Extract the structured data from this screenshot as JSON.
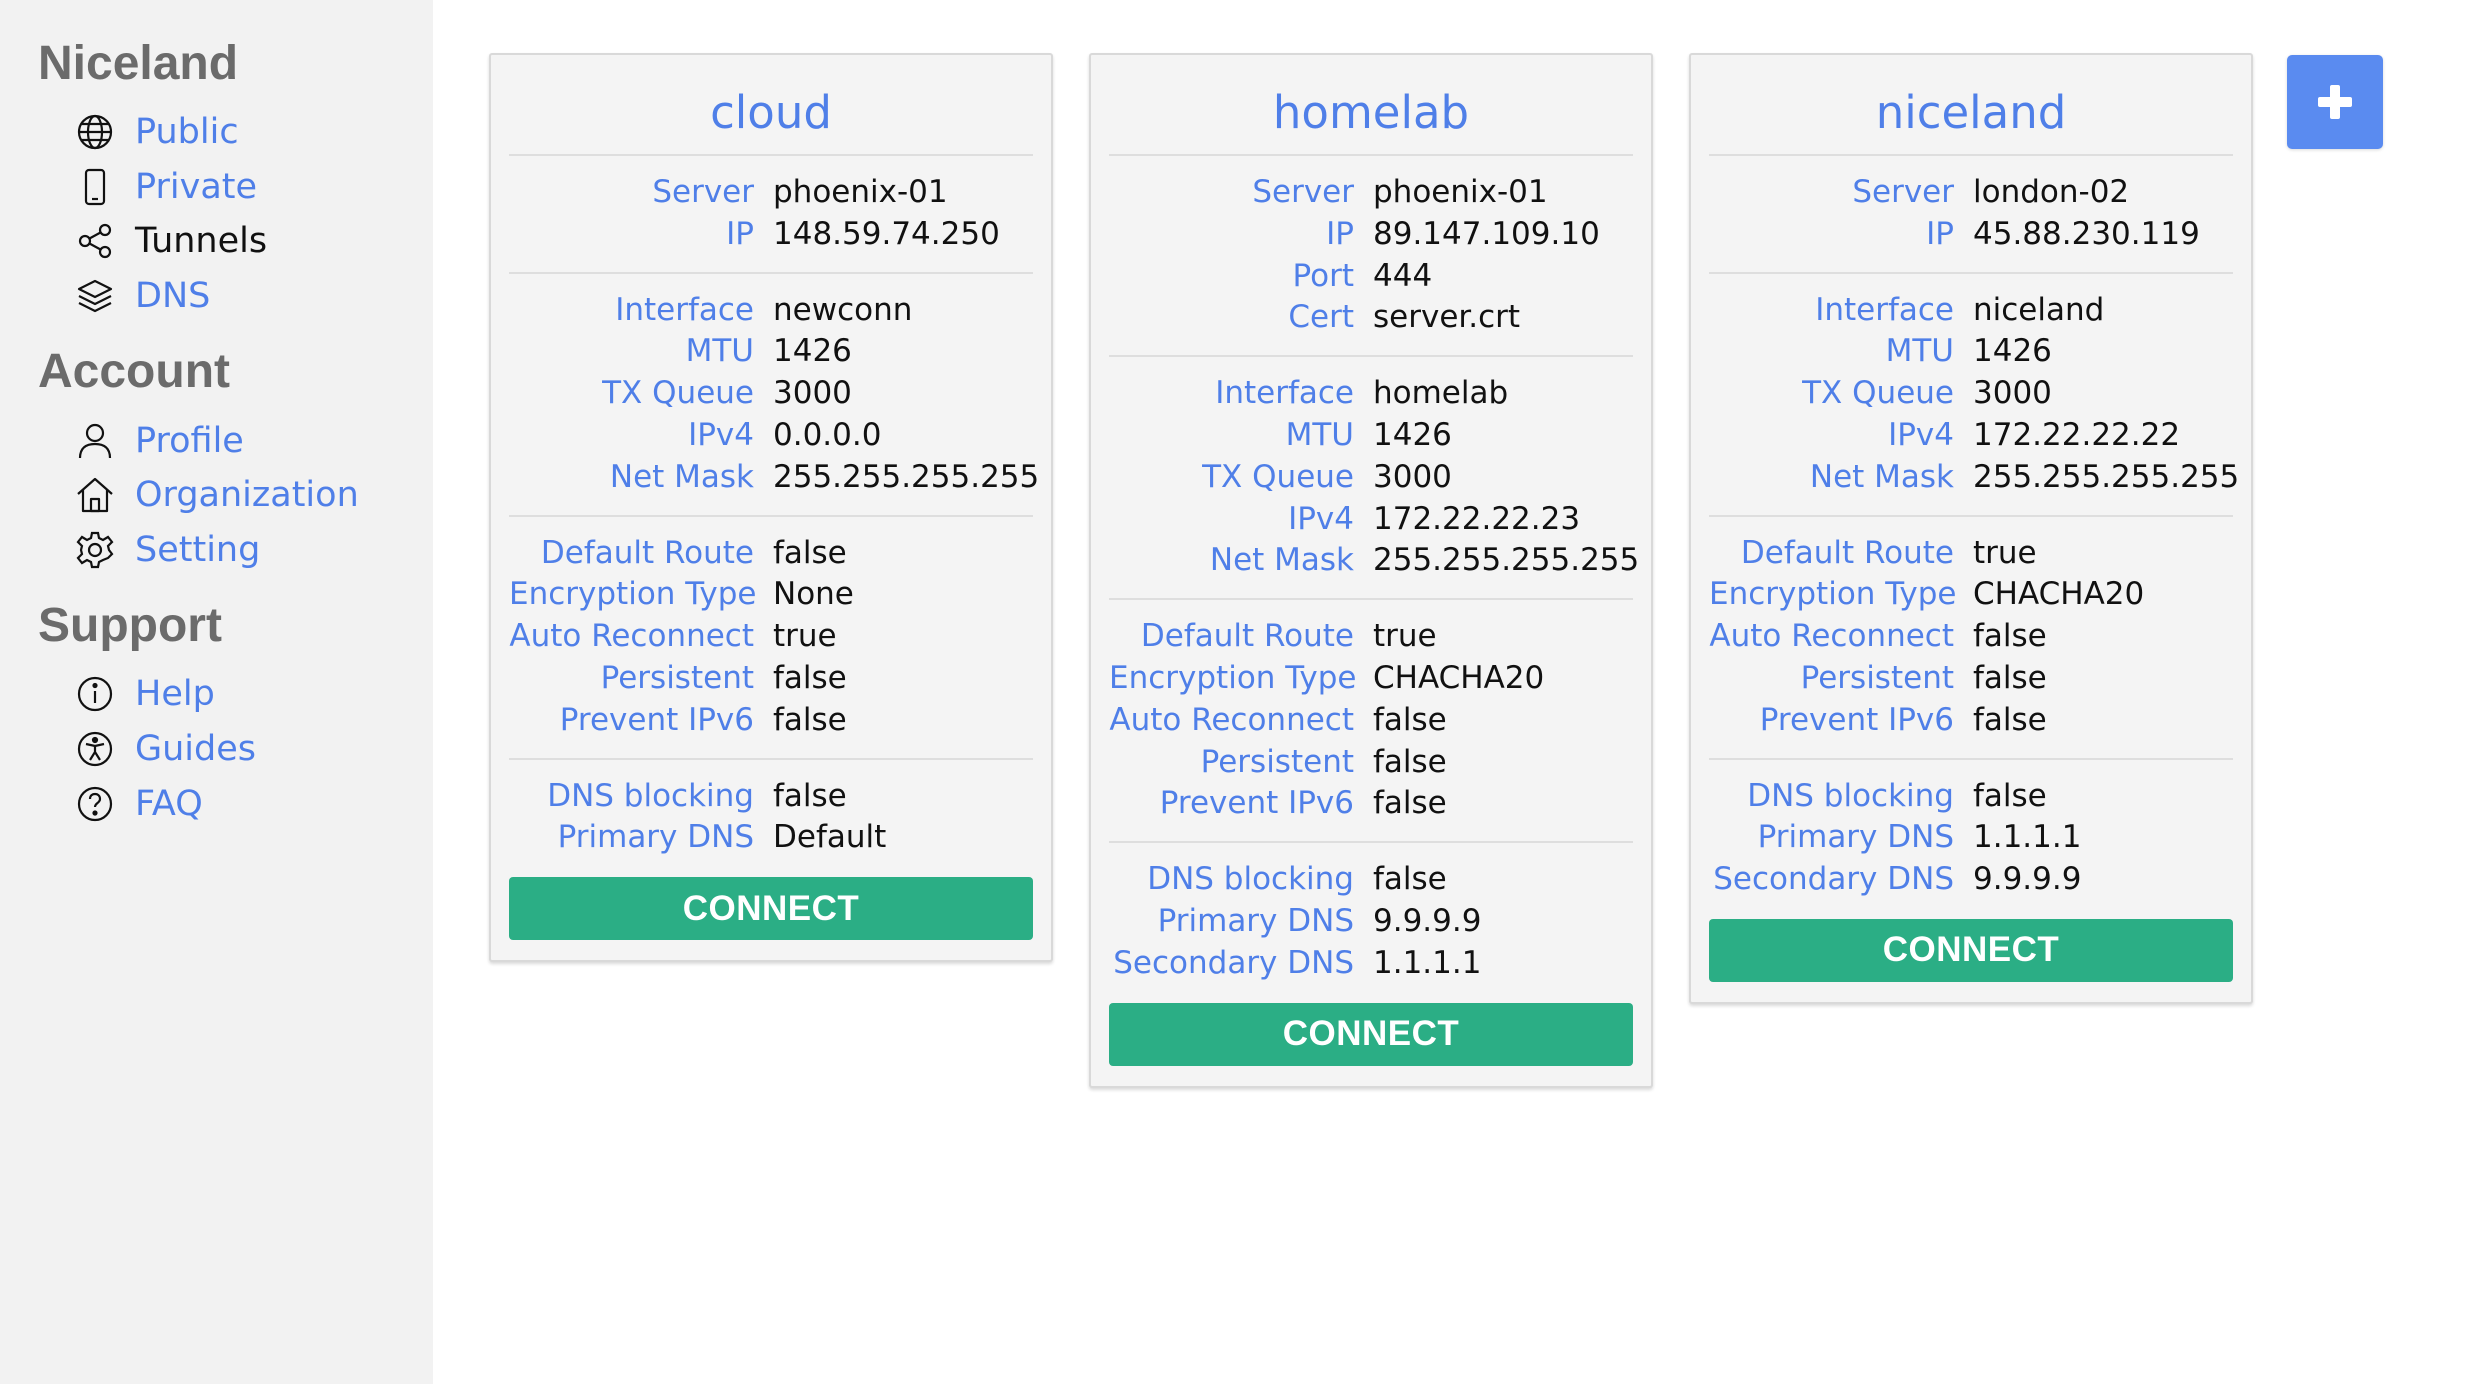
{
  "sidebar": {
    "brand": "Niceland",
    "main_items": [
      {
        "label": "Public",
        "icon": "globe-icon"
      },
      {
        "label": "Private",
        "icon": "phone-icon"
      },
      {
        "label": "Tunnels",
        "icon": "share-nodes-icon"
      },
      {
        "label": "DNS",
        "icon": "layers-icon"
      }
    ],
    "account_heading": "Account",
    "account_items": [
      {
        "label": "Profile",
        "icon": "user-icon"
      },
      {
        "label": "Organization",
        "icon": "home-icon"
      },
      {
        "label": "Setting",
        "icon": "gear-icon"
      }
    ],
    "support_heading": "Support",
    "support_items": [
      {
        "label": "Help",
        "icon": "info-icon"
      },
      {
        "label": "Guides",
        "icon": "accessibility-icon"
      },
      {
        "label": "FAQ",
        "icon": "question-icon"
      }
    ],
    "active_item": "Tunnels"
  },
  "add_button": {
    "icon": "plus-icon"
  },
  "colors": {
    "accent": "#4f7fe8",
    "connect": "#2bae85",
    "add": "#5a8bf0",
    "sidebar_bg": "#f2f2f2"
  },
  "cards": [
    {
      "title": "cloud",
      "sections": [
        [
          [
            "Server",
            "phoenix-01"
          ],
          [
            "IP",
            "148.59.74.250"
          ]
        ],
        [
          [
            "Interface",
            "newconn"
          ],
          [
            "MTU",
            "1426"
          ],
          [
            "TX Queue",
            "3000"
          ],
          [
            "IPv4",
            "0.0.0.0"
          ],
          [
            "Net Mask",
            "255.255.255.255"
          ]
        ],
        [
          [
            "Default Route",
            "false"
          ],
          [
            "Encryption Type",
            "None"
          ],
          [
            "Auto Reconnect",
            "true"
          ],
          [
            "Persistent",
            "false"
          ],
          [
            "Prevent IPv6",
            "false"
          ]
        ],
        [
          [
            "DNS blocking",
            "false"
          ],
          [
            "Primary DNS",
            "Default"
          ]
        ]
      ],
      "button": "CONNECT"
    },
    {
      "title": "homelab",
      "sections": [
        [
          [
            "Server",
            "phoenix-01"
          ],
          [
            "IP",
            "89.147.109.10"
          ],
          [
            "Port",
            "444"
          ],
          [
            "Cert",
            "server.crt"
          ]
        ],
        [
          [
            "Interface",
            "homelab"
          ],
          [
            "MTU",
            "1426"
          ],
          [
            "TX Queue",
            "3000"
          ],
          [
            "IPv4",
            "172.22.22.23"
          ],
          [
            "Net Mask",
            "255.255.255.255"
          ]
        ],
        [
          [
            "Default Route",
            "true"
          ],
          [
            "Encryption Type",
            "CHACHA20"
          ],
          [
            "Auto Reconnect",
            "false"
          ],
          [
            "Persistent",
            "false"
          ],
          [
            "Prevent IPv6",
            "false"
          ]
        ],
        [
          [
            "DNS blocking",
            "false"
          ],
          [
            "Primary DNS",
            "9.9.9.9"
          ],
          [
            "Secondary DNS",
            "1.1.1.1"
          ]
        ]
      ],
      "button": "CONNECT"
    },
    {
      "title": "niceland",
      "sections": [
        [
          [
            "Server",
            "london-02"
          ],
          [
            "IP",
            "45.88.230.119"
          ]
        ],
        [
          [
            "Interface",
            "niceland"
          ],
          [
            "MTU",
            "1426"
          ],
          [
            "TX Queue",
            "3000"
          ],
          [
            "IPv4",
            "172.22.22.22"
          ],
          [
            "Net Mask",
            "255.255.255.255"
          ]
        ],
        [
          [
            "Default Route",
            "true"
          ],
          [
            "Encryption Type",
            "CHACHA20"
          ],
          [
            "Auto Reconnect",
            "false"
          ],
          [
            "Persistent",
            "false"
          ],
          [
            "Prevent IPv6",
            "false"
          ]
        ],
        [
          [
            "DNS blocking",
            "false"
          ],
          [
            "Primary DNS",
            "1.1.1.1"
          ],
          [
            "Secondary DNS",
            "9.9.9.9"
          ]
        ]
      ],
      "button": "CONNECT"
    }
  ]
}
